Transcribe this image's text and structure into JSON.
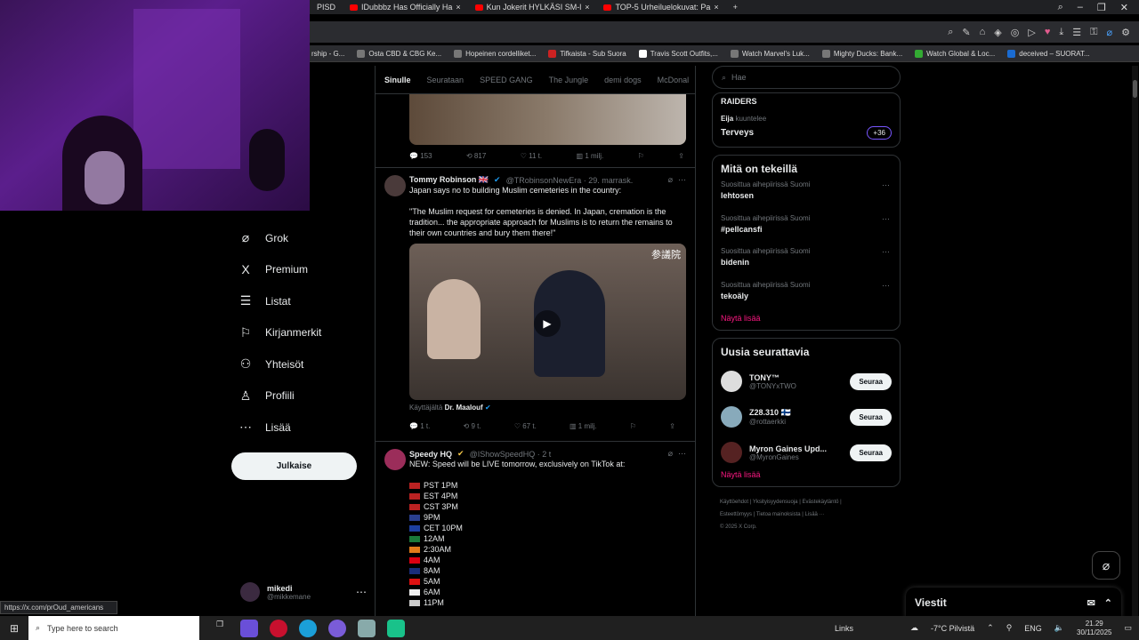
{
  "browser": {
    "tabs": [
      {
        "title": "PISD",
        "yt": false
      },
      {
        "title": "IDubbbz Has Officially Ha",
        "yt": true
      },
      {
        "title": "Kun Jokerit HYLKÄSI SM-l",
        "yt": true
      },
      {
        "title": "TOP-5 Urheiluelokuvat: Pa",
        "yt": true
      }
    ],
    "new_tab": "+",
    "bookmarks": [
      "rship - G...",
      "Osta CBD & CBG Ke...",
      "Hopeinen cordelliket...",
      "Tifkaista - Sub Suora",
      "Travis Scott Outfits,...",
      "Watch Marvel's Luk...",
      "Mighty Ducks: Bank...",
      "Watch Global & Loc...",
      "deceived – SUORAT..."
    ]
  },
  "sidebar": {
    "items": [
      {
        "icon": "grok-icon",
        "glyph": "⌀",
        "label": "Grok"
      },
      {
        "icon": "x-logo-icon",
        "glyph": "X",
        "label": "Premium"
      },
      {
        "icon": "list-icon",
        "glyph": "☰",
        "label": "Listat"
      },
      {
        "icon": "bookmark-icon",
        "glyph": "⚐",
        "label": "Kirjanmerkit"
      },
      {
        "icon": "communities-icon",
        "glyph": "⚇",
        "label": "Yhteisöt"
      },
      {
        "icon": "profile-icon",
        "glyph": "♙",
        "label": "Profiili"
      },
      {
        "icon": "more-icon",
        "glyph": "⋯",
        "label": "Lisää"
      }
    ],
    "publish": "Julkaise",
    "account": {
      "name": "mikedi",
      "handle": "@mikkemane"
    }
  },
  "feed": {
    "tabs": [
      "Sinulle",
      "Seurataan",
      "SPEED GANG",
      "The Jungle",
      "demi dogs",
      "McDonal"
    ],
    "top_actions": {
      "replies": "153",
      "reposts": "817",
      "likes": "11 t.",
      "views": "1 milj."
    },
    "tweet1": {
      "name": "Tommy Robinson 🇬🇧",
      "handle": "@TRobinsonNewEra · 29. marrask.",
      "line1": "Japan says no to building Muslim cemeteries in the country:",
      "quote": "\"The Muslim request for cemeteries is denied. In Japan, cremation is the tradition... the appropriate approach for Muslims is to return the remains to their own countries and bury them there!\"",
      "media_overlay": "参議院",
      "used_by_prefix": "Käyttäjältä",
      "used_by": "Dr. Maalouf",
      "actions": {
        "replies": "1 t.",
        "reposts": "9 t.",
        "likes": "67 t.",
        "views": "1 milj."
      }
    },
    "tweet2": {
      "name": "Speedy HQ",
      "handle": "@IShowSpeedHQ · 2 t",
      "line1": "NEW: Speed will be LIVE tomorrow, exclusively on TikTok at:",
      "times": [
        "PST 1PM",
        "EST 4PM",
        "CST 3PM",
        "9PM",
        "CET 10PM",
        "12AM",
        "2:30AM",
        "4AM",
        "8AM",
        "5AM",
        "6AM",
        "11PM"
      ]
    }
  },
  "right": {
    "search_placeholder": "Hae",
    "space": {
      "title": "RAIDERS",
      "listener": "Eija",
      "listener_suffix": "kuuntelee",
      "topic": "Terveys",
      "count": "+36"
    },
    "trends_title": "Mitä on tekeillä",
    "trends": [
      {
        "cat": "Suosittua aihepiirissä Suomi",
        "tag": "lehtosen"
      },
      {
        "cat": "Suosittua aihepiirissä Suomi",
        "tag": "#pellcansfi"
      },
      {
        "cat": "Suosittua aihepiirissä Suomi",
        "tag": "bidenin"
      },
      {
        "cat": "Suosittua aihepiirissä Suomi",
        "tag": "tekoäly"
      }
    ],
    "show_more": "Näytä lisää",
    "who_title": "Uusia seurattavia",
    "who": [
      {
        "name": "TONY™",
        "handle": "@TONYxTWO",
        "btn": "Seuraa"
      },
      {
        "name": "Z28.310 🇫🇮",
        "handle": "@rottaerkki",
        "btn": "Seuraa"
      },
      {
        "name": "Myron Gaines Upd...",
        "handle": "@MyronGaines",
        "btn": "Seuraa"
      }
    ],
    "show_more2": "Näytä lisää",
    "footer": [
      "Käyttöehdot",
      "Yksityisyydensuoja",
      "Evästekäytäntö",
      "Esteettömyys",
      "Tietoa mainoksista",
      "Lisää ···",
      "© 2025 X Corp."
    ]
  },
  "messages": {
    "label": "Viestit"
  },
  "status_url": "https://x.com/prOud_americans",
  "taskbar": {
    "search_placeholder": "Type here to search",
    "links": "Links",
    "weather": "-7°C  Pilvistä",
    "lang": "ENG",
    "time": "21.29",
    "date": "30/11/2025"
  }
}
